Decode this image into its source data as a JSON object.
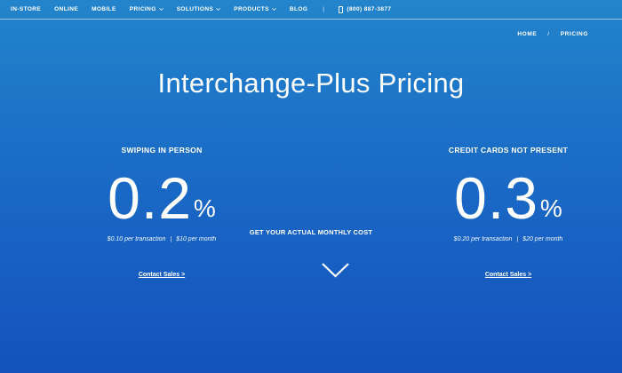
{
  "nav": {
    "items": [
      {
        "label": "IN-STORE",
        "dropdown": false
      },
      {
        "label": "ONLINE",
        "dropdown": false
      },
      {
        "label": "MOBILE",
        "dropdown": false
      },
      {
        "label": "PRICING",
        "dropdown": true
      },
      {
        "label": "SOLUTIONS",
        "dropdown": true
      },
      {
        "label": "PRODUCTS",
        "dropdown": true
      },
      {
        "label": "BLOG",
        "dropdown": false
      }
    ],
    "separator": "|",
    "phone": "(800) 887-3877"
  },
  "breadcrumb": {
    "home": "HOME",
    "separator": "/",
    "current": "PRICING"
  },
  "page_title": "Interchange-Plus Pricing",
  "plans": {
    "in_person": {
      "heading": "SWIPING IN PERSON",
      "rate": "0.2",
      "unit": "%",
      "per_transaction": "$0.10 per transaction",
      "fee_separator": "|",
      "per_month": "$10 per month",
      "contact": "Contact Sales >"
    },
    "not_present": {
      "heading": "CREDIT CARDS NOT PRESENT",
      "rate": "0.3",
      "unit": "%",
      "per_transaction": "$0.20 per transaction",
      "fee_separator": "|",
      "per_month": "$20 per month",
      "contact": "Contact Sales >"
    }
  },
  "cta": "GET YOUR ACTUAL MONTHLY COST",
  "icons": {
    "dropdown": "chevron-down-icon",
    "phone": "phone-icon",
    "scroll": "chevron-down-icon"
  },
  "colors": {
    "background_top": "#2384cb",
    "background_bottom": "#1451bd",
    "text": "#ffffff"
  }
}
